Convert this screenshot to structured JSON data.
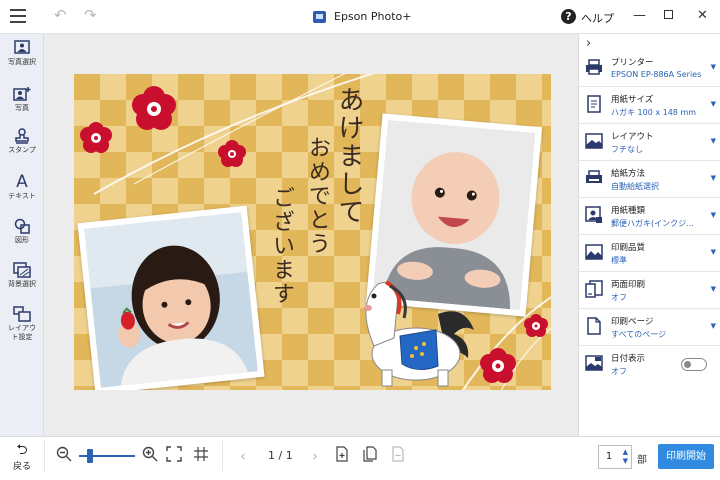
{
  "window": {
    "title": "Epson Photo+",
    "help_label": "ヘルプ",
    "help_icon": "?"
  },
  "left_tools": [
    {
      "label": "写真選択",
      "icon": "photo-select-icon"
    },
    {
      "label": "写真",
      "icon": "add-photo-icon"
    },
    {
      "label": "スタンプ",
      "icon": "stamp-icon"
    },
    {
      "label": "テキスト",
      "icon": "text-icon",
      "glyph": "A"
    },
    {
      "label": "図形",
      "icon": "shape-icon"
    },
    {
      "label": "背景選択",
      "icon": "background-icon"
    },
    {
      "label": "レイアウト設定",
      "icon": "layout-icon"
    }
  ],
  "card": {
    "greeting": [
      "あけまして",
      "おめでとう",
      "ございます"
    ],
    "colors": {
      "light": "#efd28e",
      "dark": "#e2b75a",
      "plum": "#c8102e"
    }
  },
  "settings": [
    {
      "label": "プリンター",
      "value": "EPSON EP-886A Series",
      "icon": "printer-icon"
    },
    {
      "label": "用紙サイズ",
      "value": "ハガキ 100 x 148 mm",
      "icon": "paper-size-icon"
    },
    {
      "label": "レイアウト",
      "value": "フチなし",
      "icon": "layout-icon"
    },
    {
      "label": "給紙方法",
      "value": "自動給紙選択",
      "icon": "paper-feed-icon"
    },
    {
      "label": "用紙種類",
      "value": "郵便ハガキ(インクジ...",
      "icon": "paper-type-icon"
    },
    {
      "label": "印刷品質",
      "value": "標準",
      "icon": "quality-icon"
    },
    {
      "label": "両面印刷",
      "value": "オフ",
      "icon": "duplex-icon"
    },
    {
      "label": "印刷ページ",
      "value": "すべてのページ",
      "icon": "pages-icon"
    },
    {
      "label": "日付表示",
      "value": "オフ",
      "icon": "date-icon",
      "toggle": false
    }
  ],
  "bottom": {
    "back_label": "戻る",
    "page_indicator": "1 / 1",
    "copies": "1",
    "copies_unit": "部",
    "print_label": "印刷開始",
    "accent": "#2f8ae0"
  }
}
